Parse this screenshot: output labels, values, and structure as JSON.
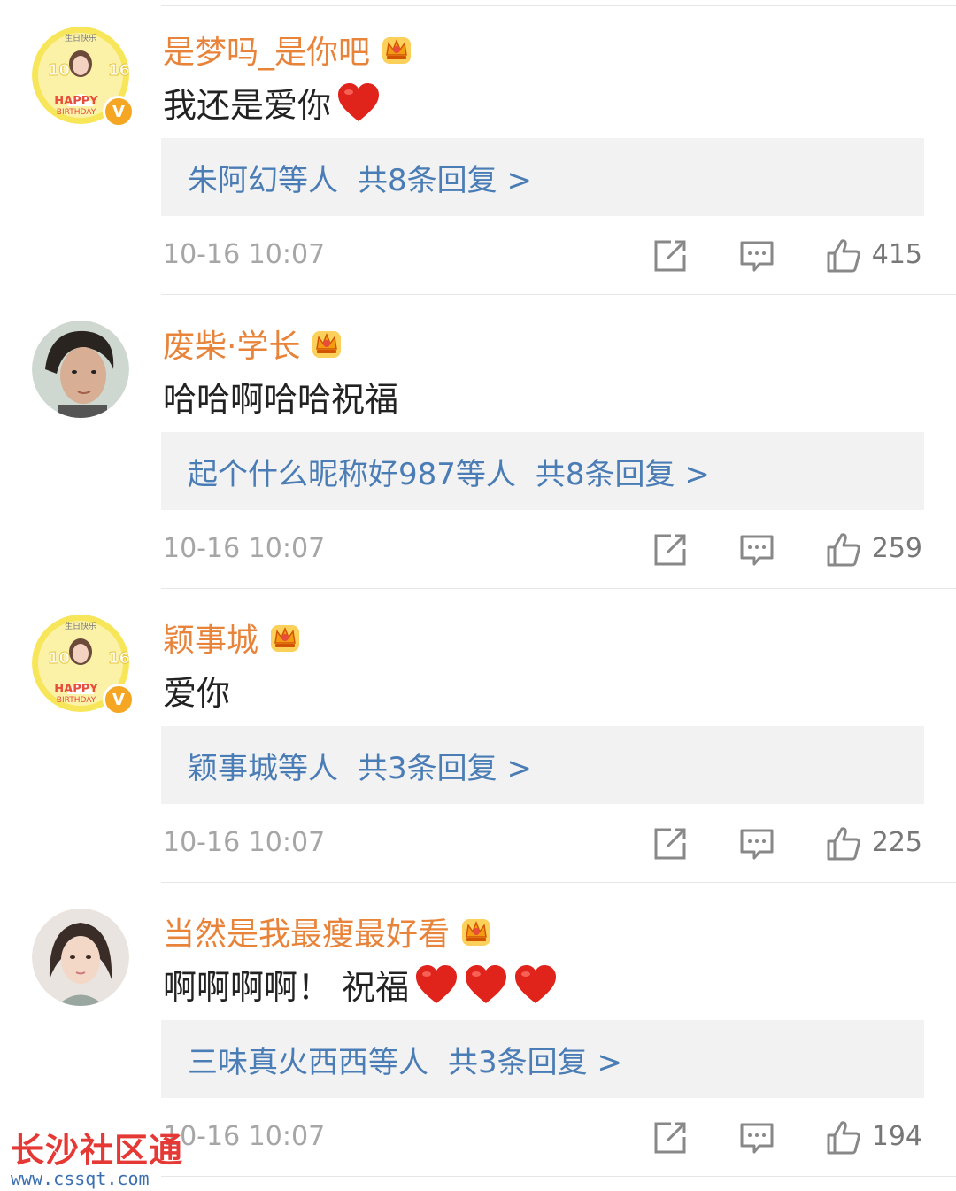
{
  "comments": [
    {
      "avatar": "birthday-avatar",
      "verified": true,
      "username": "是梦吗_是你吧",
      "text": "我还是爱你",
      "hearts": 1,
      "reply_names": "朱阿幻等人",
      "reply_count_text": "共8条回复 >",
      "time": "10-16 10:07",
      "likes": "415"
    },
    {
      "avatar": "young-man-avatar",
      "verified": false,
      "username": "废柴·学长",
      "text": "哈哈啊哈哈祝福",
      "hearts": 0,
      "reply_names": "起个什么昵称好987等人",
      "reply_count_text": "共8条回复 >",
      "time": "10-16 10:07",
      "likes": "259"
    },
    {
      "avatar": "birthday-avatar",
      "verified": true,
      "username": "颖事城",
      "text": "爱你",
      "hearts": 0,
      "reply_names": "颖事城等人",
      "reply_count_text": "共3条回复 >",
      "time": "10-16 10:07",
      "likes": "225"
    },
    {
      "avatar": "young-woman-avatar",
      "verified": false,
      "username": "当然是我最瘦最好看",
      "text": "啊啊啊啊！ 祝福",
      "hearts": 3,
      "reply_names": "三味真火西西等人",
      "reply_count_text": "共3条回复 >",
      "time": "10-16 10:07",
      "likes": "194"
    }
  ],
  "icons": {
    "share": "share-icon",
    "comment": "comment-icon",
    "like": "thumbs-up-icon",
    "crown": "crown-badge-icon",
    "heart": "red-heart-emoji"
  },
  "colors": {
    "username": "#e8833a",
    "reply_link": "#4a7cb5",
    "reply_bg": "#f2f2f2",
    "meta": "#a6a6a6",
    "heart": "#e0241c"
  },
  "watermark": {
    "title": "长沙社区通",
    "url": "www.cssqt.com"
  }
}
